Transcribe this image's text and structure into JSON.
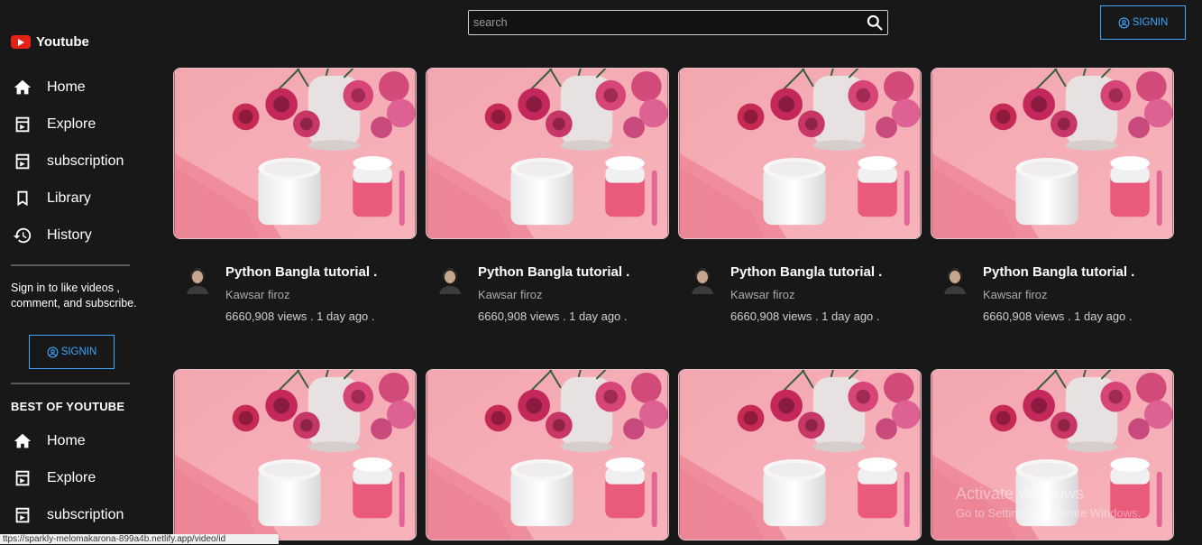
{
  "app": {
    "logo_text": "Youtube"
  },
  "header": {
    "search_placeholder": "search",
    "signin_label": "SIGNIN"
  },
  "sidebar": {
    "nav": [
      {
        "label": "Home",
        "icon": "home-icon"
      },
      {
        "label": "Explore",
        "icon": "explore-icon"
      },
      {
        "label": "subscription",
        "icon": "subscription-icon"
      },
      {
        "label": "Library",
        "icon": "library-icon"
      },
      {
        "label": "History",
        "icon": "history-icon"
      }
    ],
    "signin_note": "Sign in to like videos , comment, and subscribe.",
    "signin_label": "SIGNIN",
    "best_of_title": "BEST OF YOUTUBE",
    "best_of": [
      {
        "label": "Home",
        "icon": "home-icon"
      },
      {
        "label": "Explore",
        "icon": "explore-icon"
      },
      {
        "label": "subscription",
        "icon": "subscription-icon"
      }
    ]
  },
  "videos": [
    {
      "title": "Python Bangla tutorial .",
      "channel": "Kawsar firoz",
      "stats": "6660,908 views . 1 day ago ."
    },
    {
      "title": "Python Bangla tutorial .",
      "channel": "Kawsar firoz",
      "stats": "6660,908 views . 1 day ago ."
    },
    {
      "title": "Python Bangla tutorial .",
      "channel": "Kawsar firoz",
      "stats": "6660,908 views . 1 day ago ."
    },
    {
      "title": "Python Bangla tutorial .",
      "channel": "Kawsar firoz",
      "stats": "6660,908 views . 1 day ago ."
    },
    {
      "title": "",
      "channel": "",
      "stats": ""
    },
    {
      "title": "",
      "channel": "",
      "stats": ""
    },
    {
      "title": "",
      "channel": "",
      "stats": ""
    },
    {
      "title": "",
      "channel": "",
      "stats": ""
    }
  ],
  "watermark": {
    "line1": "Activate Windows",
    "line2": "Go to Settings to activate Windows."
  },
  "status_url": "ttps://sparkly-melomakarona-899a4b.netlify.app/video/id",
  "colors": {
    "accent": "#3ea6ff",
    "brand": "#e62117",
    "background": "#181818"
  }
}
